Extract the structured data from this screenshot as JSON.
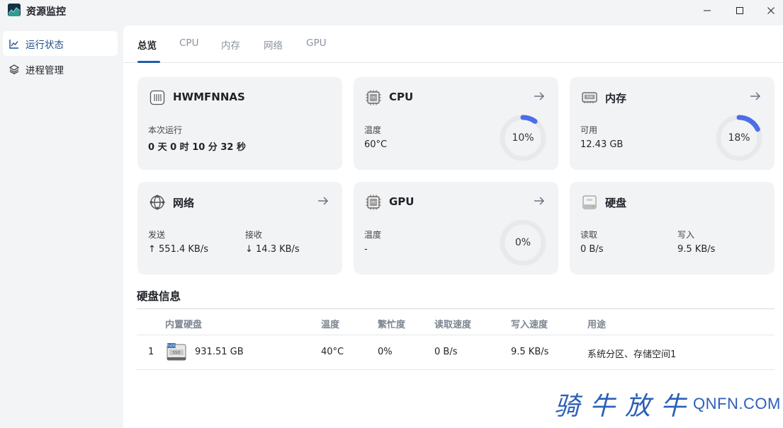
{
  "window": {
    "title": "资源监控"
  },
  "sidebar": {
    "items": [
      {
        "label": "运行状态",
        "icon": "line-chart-icon",
        "active": true
      },
      {
        "label": "进程管理",
        "icon": "layers-icon",
        "active": false
      }
    ]
  },
  "tabs": [
    {
      "label": "总览",
      "active": true
    },
    {
      "label": "CPU"
    },
    {
      "label": "内存"
    },
    {
      "label": "网络"
    },
    {
      "label": "GPU"
    }
  ],
  "cards": {
    "system": {
      "title": "HWMFNNAS",
      "uptime_label": "本次运行",
      "uptime_value": "0 天 0 时 10 分 32 秒"
    },
    "cpu": {
      "title": "CPU",
      "temp_label": "温度",
      "temp_value": "60°C",
      "usage_text": "10%",
      "usage_fraction": 0.1
    },
    "memory": {
      "title": "内存",
      "avail_label": "可用",
      "avail_value": "12.43 GB",
      "usage_text": "18%",
      "usage_fraction": 0.18
    },
    "network": {
      "title": "网络",
      "send_label": "发送",
      "send_value": "↑ 551.4 KB/s",
      "recv_label": "接收",
      "recv_value": "↓ 14.3 KB/s"
    },
    "gpu": {
      "title": "GPU",
      "temp_label": "温度",
      "temp_value": "-",
      "usage_text": "0%",
      "usage_fraction": 0.0
    },
    "disk": {
      "title": "硬盘",
      "read_label": "读取",
      "read_value": "0 B/s",
      "write_label": "写入",
      "write_value": "9.5 KB/s"
    }
  },
  "disk_info": {
    "title": "硬盘信息",
    "columns": [
      "内置硬盘",
      "温度",
      "繁忙度",
      "读取速度",
      "写入速度",
      "用途"
    ],
    "rows": [
      {
        "index": "1",
        "capacity": "931.51 GB",
        "temp": "40°C",
        "busy": "0%",
        "read": "0 B/s",
        "write": "9.5 KB/s",
        "usage": "系统分区、存储空间1",
        "badge": "fnOS",
        "icon_label": "SSD"
      }
    ]
  },
  "watermark": {
    "cn": "骑牛放牛",
    "en": "QNFN.COM"
  },
  "colors": {
    "accent": "#1f5ea8",
    "gauge": "#4d6ee8",
    "gauge_track": "#e8e9ec",
    "watermark": "#2b5fb8"
  }
}
